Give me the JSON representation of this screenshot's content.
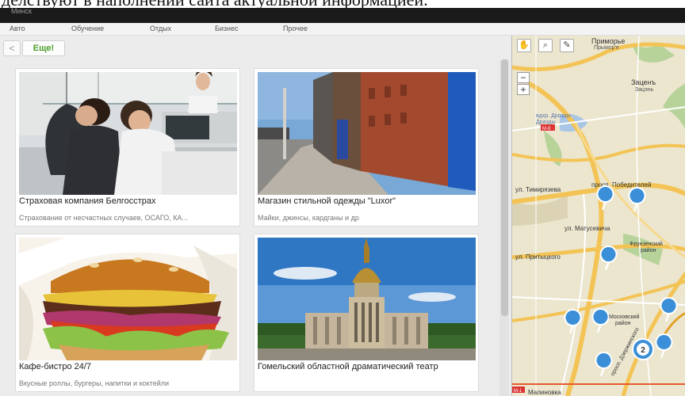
{
  "header": {
    "caption": "делствуют в наполнении сайта актуальной информацией.",
    "city": "Минск"
  },
  "nav": {
    "items": [
      "Авто",
      "Обучение",
      "Отдых",
      "Бизнес",
      "Прочее"
    ]
  },
  "toolbar": {
    "back_label": "<",
    "more_label": "Еще!"
  },
  "cards": [
    {
      "title": "Страховая компания Белгосстрах",
      "desc": "Страхование от несчастных случаев, ОСАГО, КА..."
    },
    {
      "title": "Магазин стильной одежды \"Luxor\"",
      "desc": "Майки, джинсы, кардганы и др"
    },
    {
      "title": "Кафе-бистро 24/7",
      "desc": "Вкусные роллы, бургеры, напитки и коктейли"
    },
    {
      "title": "Гомельский областной драматический театр",
      "desc": ""
    }
  ],
  "map": {
    "labels": {
      "primorye": "Приморье",
      "primorye_sub": "Прымор'е",
      "zatsen": "Заценъ",
      "zatsen_sub": "Зацэнь",
      "m9": "М-9",
      "reservoir": "вдхр. Дрозды",
      "reservoir_sub": "Дразды",
      "timiryazeva": "ул. Тимирязева",
      "pobediteley": "просп. Победителей",
      "matusevicha": "ул. Матусевича",
      "frunzensky": "Фрунзенский",
      "frunzensky_sub": "район",
      "pritytskogo": "ул. Притыцкого",
      "moskovsky": "Московский",
      "moskovsky_sub": "район",
      "dzerzhinskogo": "просп. Дзержинского",
      "malinovka": "Малиновка",
      "m1": "М-1"
    },
    "cluster_count": "2",
    "zoom_in": "+",
    "zoom_out": "−"
  }
}
